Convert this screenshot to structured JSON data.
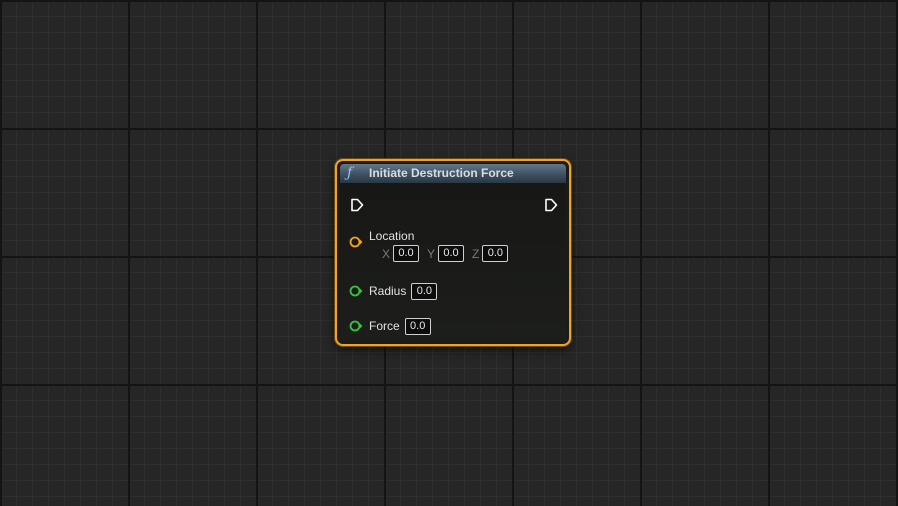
{
  "node": {
    "title": "Initiate Destruction Force",
    "title_icon": "function-icon",
    "header_colors": [
      "#62788a",
      "#2a3844"
    ],
    "border_color": "#f1a51e",
    "exec_in": "exec-in-pin",
    "exec_out": "exec-out-pin",
    "inputs": [
      {
        "label": "Location",
        "type": "vector",
        "pin_color": "#f1a51e",
        "components": [
          {
            "axis": "X",
            "value": "0.0"
          },
          {
            "axis": "Y",
            "value": "0.0"
          },
          {
            "axis": "Z",
            "value": "0.0"
          }
        ]
      },
      {
        "label": "Radius",
        "type": "float",
        "pin_color": "#38c43a",
        "value": "0.0"
      },
      {
        "label": "Force",
        "type": "float",
        "pin_color": "#38c43a",
        "value": "0.0"
      }
    ]
  }
}
